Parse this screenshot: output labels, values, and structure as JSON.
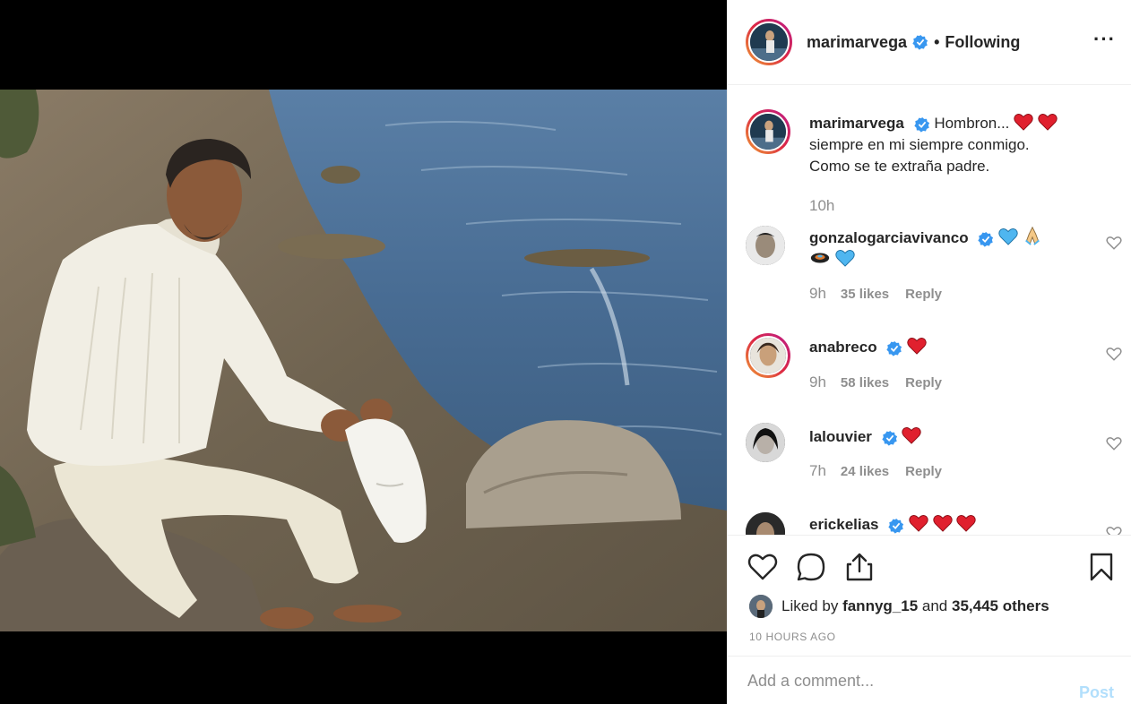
{
  "post": {
    "author": "marimarvega",
    "follow_state": "Following",
    "more_icon": "more-options-icon"
  },
  "caption": {
    "username": "marimarvega",
    "text_line1": "Hombron...",
    "text_line2": "siempre en mi siempre conmigo.",
    "text_line3": "Como se te extraña padre.",
    "time": "10h"
  },
  "comments": [
    {
      "username": "gonzalogarciavivanco",
      "time": "9h",
      "likes": "35 likes",
      "reply": "Reply"
    },
    {
      "username": "anabreco",
      "time": "9h",
      "likes": "58 likes",
      "reply": "Reply"
    },
    {
      "username": "lalouvier",
      "time": "7h",
      "likes": "24 likes",
      "reply": "Reply"
    },
    {
      "username": "erickelias"
    }
  ],
  "likes": {
    "prefix": "Liked by",
    "user": "fannyg_15",
    "conj": "and",
    "others": "35,445 others"
  },
  "timestamp": "10 HOURS AGO",
  "add_comment": {
    "placeholder": "Add a comment...",
    "post_label": "Post"
  },
  "colors": {
    "verified": "#3897f0",
    "heart_red": "#ed4956",
    "link_muted": "#b2dffc",
    "text_muted": "#8e8e8e"
  }
}
